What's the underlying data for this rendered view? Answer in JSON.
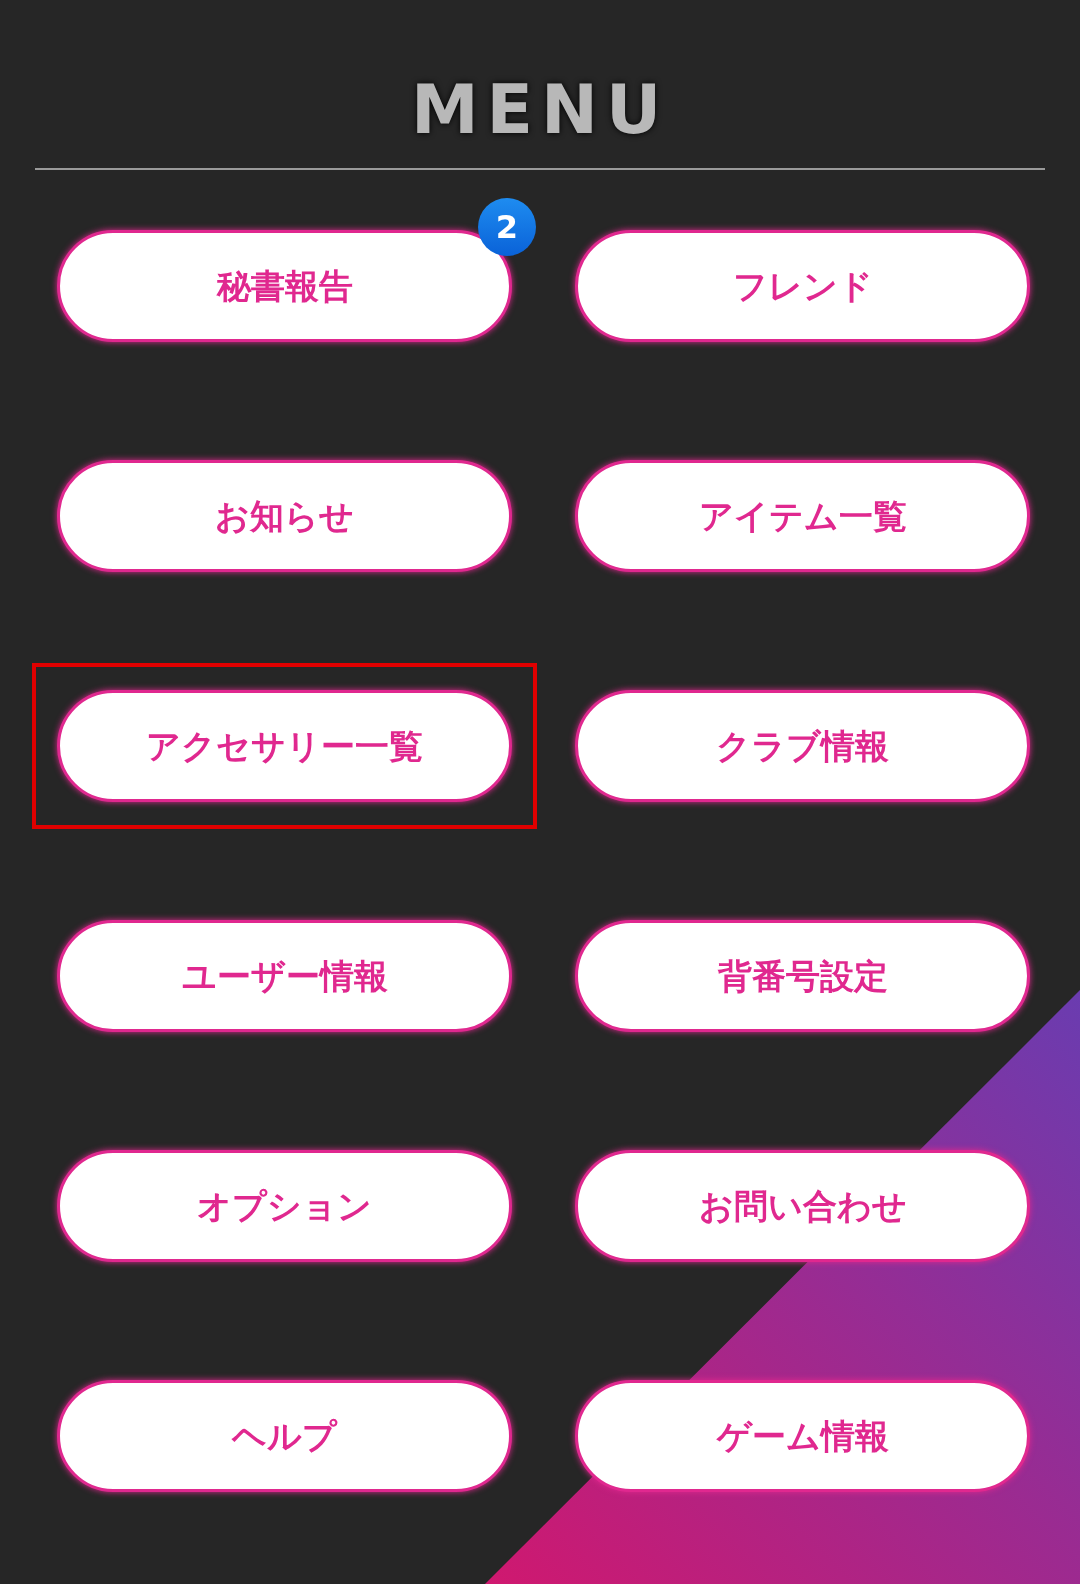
{
  "title": "MENU",
  "items": [
    {
      "label": "秘書報告",
      "badge": "2",
      "highlighted": false
    },
    {
      "label": "フレンド",
      "highlighted": false
    },
    {
      "label": "お知らせ",
      "highlighted": false
    },
    {
      "label": "アイテム一覧",
      "highlighted": false
    },
    {
      "label": "アクセサリー一覧",
      "highlighted": true
    },
    {
      "label": "クラブ情報",
      "highlighted": false
    },
    {
      "label": "ユーザー情報",
      "highlighted": false
    },
    {
      "label": "背番号設定",
      "highlighted": false
    },
    {
      "label": "オプション",
      "highlighted": false
    },
    {
      "label": "お問い合わせ",
      "highlighted": false
    },
    {
      "label": "ヘルプ",
      "highlighted": false
    },
    {
      "label": "ゲーム情報",
      "highlighted": false
    }
  ]
}
